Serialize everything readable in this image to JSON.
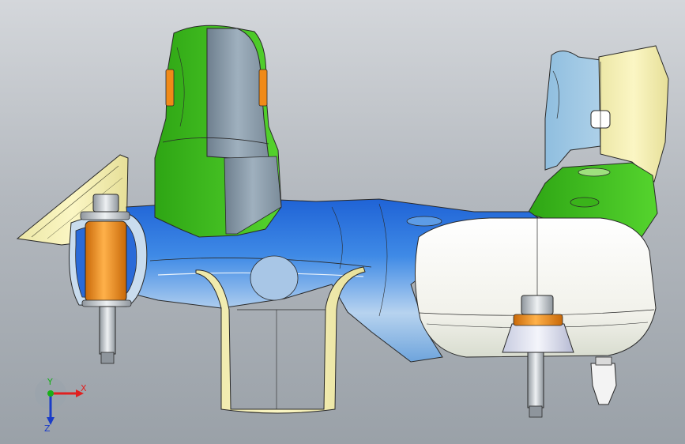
{
  "viewport": {
    "background_top": "#d4d7db",
    "background_bottom": "#9aa1a8"
  },
  "model": {
    "colors": {
      "blue_body": "#2f7be0",
      "blue_light": "#b8d4f0",
      "green_tower": "#3ec21f",
      "steel_gray": "#8a9aa8",
      "cream": "#f4eeaa",
      "white_pad": "#f6f6f0",
      "light_blue_bracket": "#a9cde6",
      "orange_bushing": "#f08a18",
      "bolt_gray": "#c6cbd0",
      "edge": "#2a2a2a"
    }
  },
  "triad": {
    "x_label": "X",
    "y_label": "Y",
    "z_label": "Z",
    "x_color": "#e02020",
    "y_color": "#18b018",
    "z_color": "#1a3cc8"
  }
}
